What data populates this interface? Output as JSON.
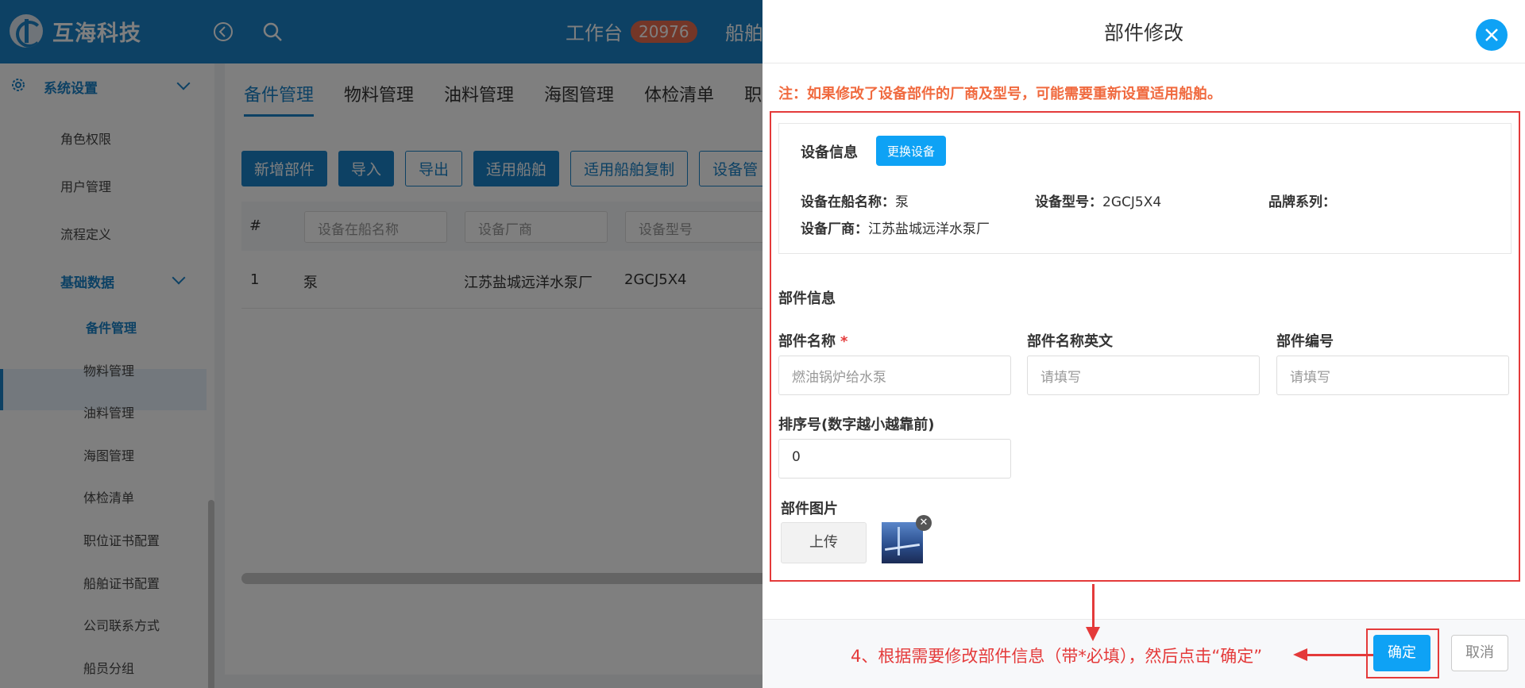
{
  "app": {
    "logo_text": "互海科技",
    "nav_workbench": "工作台",
    "nav_workbench_badge": "20976",
    "nav_next": "船舶"
  },
  "sidebar": {
    "system_settings": "系统设置",
    "items": [
      "角色权限",
      "用户管理",
      "流程定义"
    ],
    "group_basic": "基础数据",
    "sub_items": [
      "备件管理",
      "物料管理",
      "油料管理",
      "海图管理",
      "体检清单",
      "职位证书配置",
      "船舶证书配置",
      "公司联系方式",
      "船员分组"
    ]
  },
  "main": {
    "tabs": [
      "备件管理",
      "物料管理",
      "油料管理",
      "海图管理",
      "体检清单",
      "职位证"
    ],
    "buttons": [
      "新增部件",
      "导入",
      "导出",
      "适用船舶",
      "适用船舶复制",
      "设备管"
    ],
    "table_hash": "#",
    "filters": [
      "设备在船名称",
      "设备厂商",
      "设备型号"
    ],
    "row": {
      "index": "1",
      "name": "泵",
      "maker": "江苏盐城远洋水泵厂",
      "model": "2GCJ5X4"
    }
  },
  "drawer": {
    "title": "部件修改",
    "notice": "注：如果修改了设备部件的厂商及型号，可能需要重新设置适用船舶。",
    "device_info_title": "设备信息",
    "change_device_button": "更换设备",
    "device_name_label": "设备在船名称：",
    "device_name_value": "泵",
    "device_model_label": "设备型号：",
    "device_model_value": "2GCJ5X4",
    "brand_series_label": "品牌系列：",
    "device_maker_label": "设备厂商：",
    "device_maker_value": "江苏盐城远洋水泵厂",
    "part_info_title": "部件信息",
    "part_name_label": "部件名称",
    "part_name_required": "*",
    "part_name_value": "燃油锅炉给水泵",
    "part_name_en_label": "部件名称英文",
    "part_name_en_placeholder": "请填写",
    "part_no_label": "部件编号",
    "part_no_placeholder": "请填写",
    "sort_label": "排序号(数字越小越靠前)",
    "sort_value": "0",
    "image_label": "部件图片",
    "upload_button": "上传",
    "annotation": "4、根据需要修改部件信息（带*必填），然后点击“确定”",
    "confirm_button": "确定",
    "cancel_button": "取消"
  }
}
